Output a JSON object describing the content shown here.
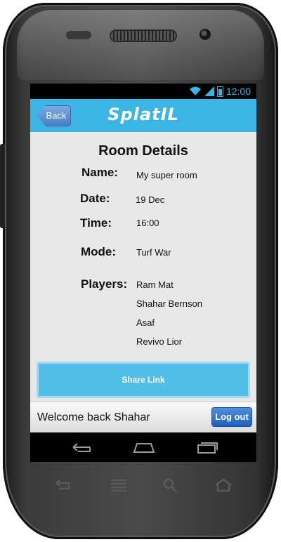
{
  "status_bar": {
    "time": "12:00"
  },
  "app_bar": {
    "back_label": "Back",
    "title": "SplatIL"
  },
  "room": {
    "heading": "Room Details",
    "fields": [
      {
        "label": "Name:",
        "value": "My super room"
      },
      {
        "label": "Date:",
        "value": "19 Dec"
      },
      {
        "label": "Time:",
        "value": "16:00"
      },
      {
        "label": "Mode:",
        "value": "Turf War"
      }
    ],
    "players_label": "Players:",
    "players": [
      "Ram Mat",
      "Shahar Bernson",
      "Asaf",
      "Revivo Lior"
    ]
  },
  "share": {
    "label": "Share Link"
  },
  "footer": {
    "welcome": "Welcome back Shahar",
    "logout_label": "Log out"
  },
  "colors": {
    "accent": "#3db5e4",
    "share": "#52bde6",
    "logout": "#2a6fcf",
    "status": "#3ab4e5"
  },
  "icons": {
    "status": [
      "wifi-icon",
      "signal-icon",
      "battery-icon"
    ],
    "nav": [
      "back-icon",
      "home-icon",
      "recents-icon"
    ],
    "hardware": [
      "hw-back-icon",
      "hw-menu-icon",
      "hw-search-icon",
      "hw-home-icon"
    ]
  }
}
